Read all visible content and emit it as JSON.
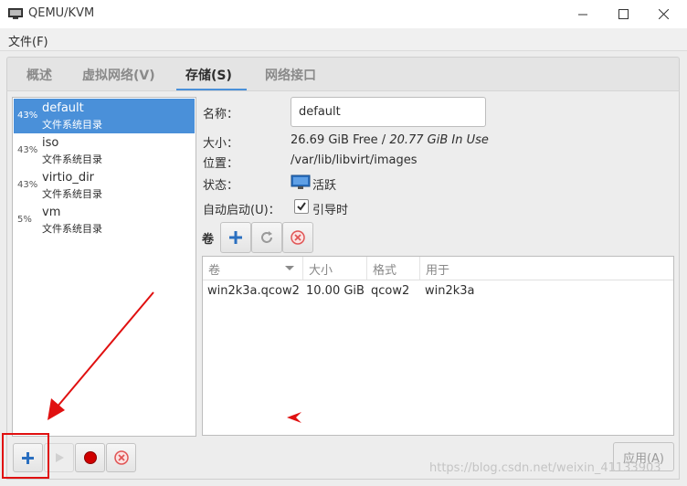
{
  "window": {
    "title": "QEMU/KVM",
    "icon": "computer-icon"
  },
  "menu": {
    "file": "文件(F)"
  },
  "tabs": [
    {
      "label": "概述"
    },
    {
      "label": "虚拟网络(V)"
    },
    {
      "label": "存储(S)"
    },
    {
      "label": "网络接口"
    }
  ],
  "active_tab": "存储(S)",
  "pools": [
    {
      "pct": "43%",
      "name": "default",
      "type": "文件系统目录"
    },
    {
      "pct": "43%",
      "name": "iso",
      "type": "文件系统目录"
    },
    {
      "pct": "43%",
      "name": "virtio_dir",
      "type": "文件系统目录"
    },
    {
      "pct": "5%",
      "name": "vm",
      "type": "文件系统目录"
    }
  ],
  "details": {
    "name_label": "名称：",
    "name_value": "default",
    "size_label": "大小：",
    "size_free": "26.69 GiB Free / ",
    "size_used": "20.77 GiB In Use",
    "location_label": "位置：",
    "location_value": "/var/lib/libvirt/images",
    "state_label": "状态：",
    "state_value": "活跃",
    "autostart_label": "自动启动(U)：",
    "autostart_value": "引导时",
    "autostart_checked": true
  },
  "volumes": {
    "label": "卷",
    "columns": [
      "卷",
      "大小",
      "格式",
      "用于"
    ],
    "rows": [
      [
        "win2k3a.qcow2",
        "10.00 GiB",
        "qcow2",
        "win2k3a"
      ]
    ]
  },
  "buttons": {
    "apply": "应用(A)"
  },
  "watermark": "https://blog.csdn.net/weixin_41133903",
  "colors": {
    "selection": "#4a90d9",
    "annotation": "#e01010"
  }
}
